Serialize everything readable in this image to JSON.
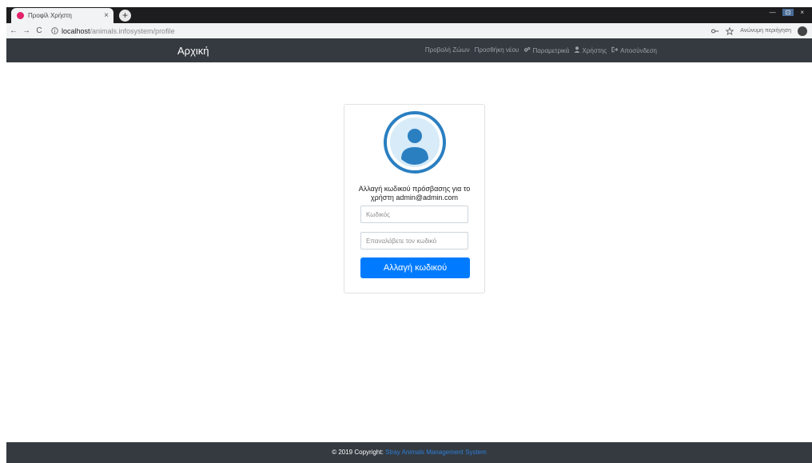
{
  "browser": {
    "tab_title": "Προφίλ Χρήστη",
    "tab_close": "×",
    "new_tab": "+",
    "window_controls": [
      "—",
      "⊡",
      "×"
    ],
    "nav": {
      "back": "←",
      "forward": "→",
      "reload": "C"
    },
    "url_host": "localhost",
    "url_path": "/animals.infosystem/profile",
    "profile_label": "Ανώνυμη περιήγηση",
    "colors": {
      "favicon": "#e2226b"
    }
  },
  "navbar": {
    "brand": "Αρχική",
    "links": [
      {
        "label": "Προβολή Ζώων",
        "icon": ""
      },
      {
        "label": "Προσθήκη νέου",
        "icon": ""
      },
      {
        "label": "Παραμετρικά",
        "icon": "gears-icon"
      },
      {
        "label": "Χρήστης",
        "icon": "user-icon"
      },
      {
        "label": "Αποσύνδεση",
        "icon": "sign-out-icon"
      }
    ]
  },
  "card": {
    "heading": "Αλλαγή κωδικού πρόσβασης για το χρήστη admin@admin.com",
    "password_placeholder": "Κωδικός",
    "repeat_placeholder": "Επαναλάβετε τον κωδικό",
    "submit_label": "Αλλαγή κωδικού",
    "colors": {
      "accent": "#007bff",
      "avatar_ring": "#2a7fc1"
    }
  },
  "footer": {
    "text": "© 2019 Copyright:",
    "link": "Stray Animals Management System"
  }
}
